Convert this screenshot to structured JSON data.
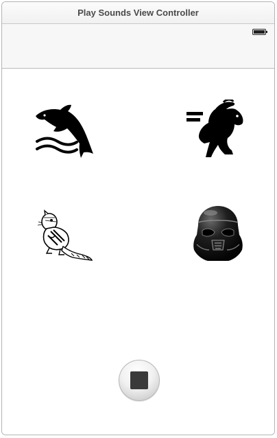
{
  "scene": {
    "title": "Play Sounds View Controller"
  },
  "status_bar": {
    "battery_icon": "battery-icon"
  },
  "buttons": {
    "slow": {
      "icon": "dolphin-icon"
    },
    "fast": {
      "icon": "rabbit-icon"
    },
    "chipmunk": {
      "icon": "chipmunk-icon"
    },
    "darth_vader": {
      "icon": "stormtrooper-helmet-icon"
    },
    "stop": {
      "icon": "stop-icon"
    }
  },
  "colors": {
    "icon": "#000000",
    "stop_square": "#3a3a3a",
    "title_text": "#4a4a4a"
  }
}
